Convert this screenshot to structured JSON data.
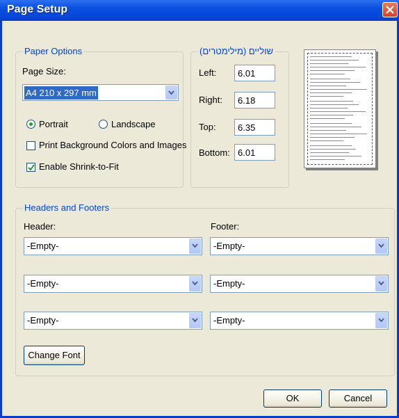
{
  "window": {
    "title": "Page Setup"
  },
  "paper_options": {
    "legend": "Paper Options",
    "page_size_label": "Page Size:",
    "page_size_value": "A4 210 x 297 mm",
    "portrait_label": "Portrait",
    "landscape_label": "Landscape",
    "orientation_selected": "Portrait",
    "print_background_label": "Print Background Colors and Images",
    "print_background_checked": false,
    "shrink_to_fit_label": "Enable Shrink-to-Fit",
    "shrink_to_fit_checked": true
  },
  "margins": {
    "legend": "שוליים (מילימטרים)",
    "left_label": "Left:",
    "left_value": "6.01",
    "right_label": "Right:",
    "right_value": "6.18",
    "top_label": "Top:",
    "top_value": "6.35",
    "bottom_label": "Bottom:",
    "bottom_value": "6.01"
  },
  "headers_footers": {
    "legend": "Headers and Footers",
    "header_label": "Header:",
    "footer_label": "Footer:",
    "header_values": [
      "-Empty-",
      "-Empty-",
      "-Empty-"
    ],
    "footer_values": [
      "-Empty-",
      "-Empty-",
      "-Empty-"
    ],
    "change_font_label": "Change Font"
  },
  "buttons": {
    "ok": "OK",
    "cancel": "Cancel"
  },
  "icons": {
    "close": "close-icon",
    "dropdown": "chevron-down-icon",
    "check": "checkmark-icon"
  },
  "colors": {
    "title_bar": "#0a4fe0",
    "accent": "#0046d5",
    "dialog_bg": "#ece9d8",
    "radio_dot": "#21a121"
  }
}
